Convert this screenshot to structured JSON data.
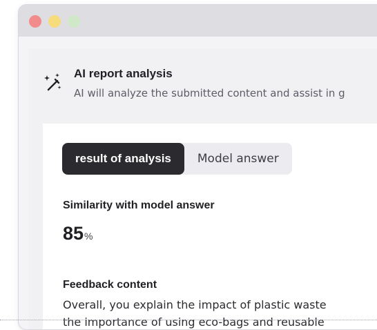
{
  "colors": {
    "accent_dark": "#2b2b2f",
    "window_dot_red": "#f28b8b",
    "window_dot_yellow": "#f6dc7a",
    "window_dot_green": "#cfe8c8"
  },
  "header": {
    "icon": "magic-wand-sparkle-icon",
    "title": "AI report analysis",
    "description": "AI will analyze the submitted content and assist in g"
  },
  "tabs": [
    {
      "label": "result of analysis",
      "active": true
    },
    {
      "label": "Model answer",
      "active": false
    }
  ],
  "similarity": {
    "label": "Similarity with model answer",
    "value": "85",
    "unit": "%"
  },
  "feedback": {
    "label": "Feedback content",
    "lines": [
      "Overall, you explain the impact of plastic waste",
      "the importance of using eco-bags and reusable"
    ]
  }
}
